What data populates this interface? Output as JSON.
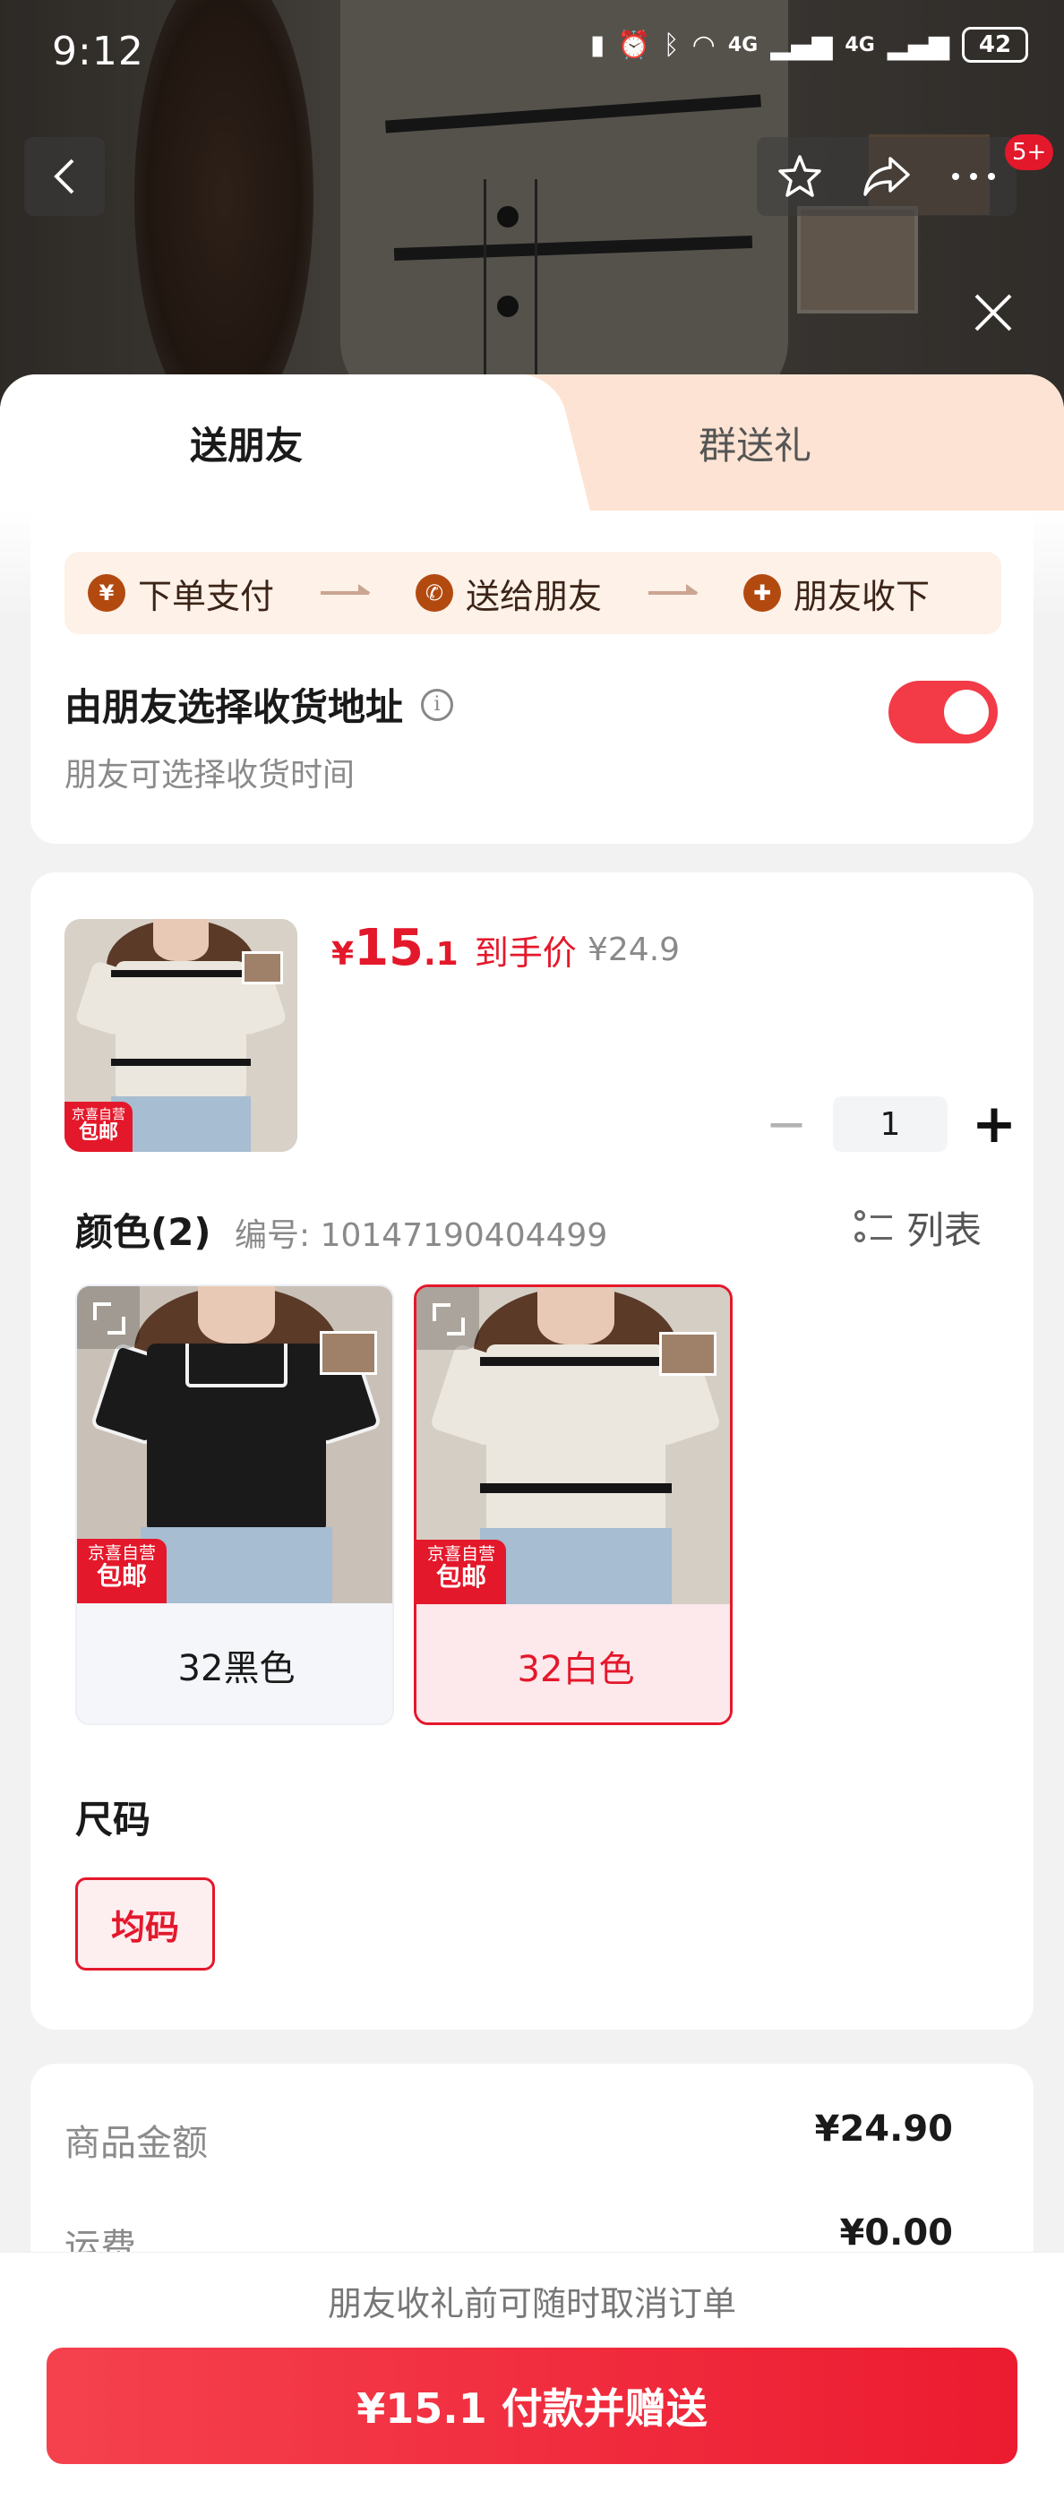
{
  "status_bar": {
    "time": "9:12",
    "signal_1": "4G",
    "signal_2": "4G",
    "battery": "42"
  },
  "header": {
    "badge": "5+",
    "back_icon": "chevron-left-icon",
    "favorite_icon": "star-icon",
    "share_icon": "share-icon",
    "more_icon": "more-icon",
    "close_icon": "close-icon"
  },
  "tabs": [
    {
      "label": "送朋友",
      "active": true
    },
    {
      "label": "群送礼",
      "active": false
    }
  ],
  "flow": {
    "steps": [
      {
        "label": "下单支付",
        "icon": "¥"
      },
      {
        "label": "送给朋友",
        "icon": "wechat-icon"
      },
      {
        "label": "朋友收下",
        "icon": "gift-icon"
      }
    ]
  },
  "address": {
    "title": "由朋友选择收货地址",
    "subtitle": "朋友可选择收货时间",
    "toggle_on": true
  },
  "product": {
    "currency": "¥",
    "price_int": "15",
    "price_dec": ".1",
    "price_label": "到手价",
    "original_price": "¥24.9",
    "tag_top": "京喜自营",
    "tag_bottom": "包邮",
    "quantity": "1",
    "minus": "−",
    "plus": "+"
  },
  "color_section": {
    "title": "颜色(2)",
    "code": "编号: 10147190404499",
    "list_label": "列表",
    "options": [
      {
        "label": "32黑色",
        "selected": false
      },
      {
        "label": "32白色",
        "selected": true
      }
    ]
  },
  "size_section": {
    "title": "尺码",
    "options": [
      {
        "label": "均码",
        "selected": true
      }
    ]
  },
  "amounts": [
    {
      "label": "商品金额",
      "value": "¥24.90"
    },
    {
      "label": "运费",
      "value": "¥0.00"
    }
  ],
  "footer": {
    "note": "朋友收礼前可随时取消订单",
    "pay_button": "¥15.1 付款并赠送"
  },
  "colors": {
    "accent": "#e4182b",
    "tab_inactive_bg": "#fde3d3",
    "flow_bg": "#fdf1e8",
    "flow_icon": "#b24a10"
  }
}
